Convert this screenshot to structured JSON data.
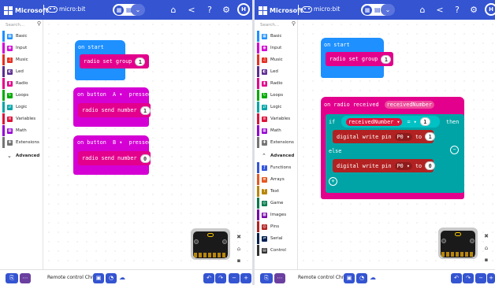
{
  "header": {
    "brand": "Microsoft",
    "product": "micro:bit",
    "toggle_blocks_icon": "blocks-icon",
    "toggle_text_icon": "text-code-icon",
    "icons": [
      "home-icon",
      "share-icon",
      "help-icon",
      "settings-icon"
    ],
    "avatar": "H"
  },
  "toolbox": {
    "search_placeholder": "Search...",
    "left_categories": [
      {
        "label": "Basic",
        "color": "#1e90ff"
      },
      {
        "label": "Input",
        "color": "#d400d4"
      },
      {
        "label": "Music",
        "color": "#e63022"
      },
      {
        "label": "Led",
        "color": "#5c2d91"
      },
      {
        "label": "Radio",
        "color": "#e3008c"
      },
      {
        "label": "Loops",
        "color": "#00aa00"
      },
      {
        "label": "Logic",
        "color": "#00a4a6"
      },
      {
        "label": "Variables",
        "color": "#dc143c"
      },
      {
        "label": "Math",
        "color": "#9400d3"
      },
      {
        "label": "Extensions",
        "color": "#757575"
      }
    ],
    "advanced_label": "Advanced",
    "right_extra": [
      {
        "label": "Functions",
        "color": "#3455db"
      },
      {
        "label": "Arrays",
        "color": "#e65722"
      },
      {
        "label": "Text",
        "color": "#b8860b"
      },
      {
        "label": "Game",
        "color": "#007a4b"
      },
      {
        "label": "Images",
        "color": "#7600a8"
      },
      {
        "label": "Pins",
        "color": "#b22222"
      },
      {
        "label": "Serial",
        "color": "#002050"
      },
      {
        "label": "Control",
        "color": "#333333"
      }
    ]
  },
  "left_blocks": {
    "on_start": "on start",
    "radio_set_group": "radio set group",
    "group_value": "1",
    "on_button_a": "on button",
    "button_a": "A",
    "pressed_a": "pressed",
    "send_a": "radio send number",
    "send_a_value": "1",
    "on_button_b": "on button",
    "button_b": "B",
    "pressed_b": "pressed",
    "send_b": "radio send number",
    "send_b_value": "0"
  },
  "right_blocks": {
    "on_start": "on start",
    "radio_set_group": "radio set group",
    "group_value": "1",
    "on_radio_received": "on radio received",
    "received_param": "receivedNumber",
    "if_label": "if",
    "cond_var": "receivedNumber",
    "cond_op": "=",
    "cond_value": "1",
    "then_label": "then",
    "write1": "digital write pin",
    "write1_pin": "P0",
    "write1_to": "to",
    "write1_value": "1",
    "else_label": "else",
    "write2": "digital write pin",
    "write2_pin": "P0",
    "write2_to": "to",
    "write2_value": "0"
  },
  "footer": {
    "project_name": "Remote control Chrism"
  },
  "colors": {
    "header": "#3454d1",
    "basic": "#1e90ff",
    "input": "#d400d4",
    "radio": "#e3008c",
    "logic": "#00a4a6",
    "variables": "#dc143c",
    "pins": "#b22222"
  }
}
